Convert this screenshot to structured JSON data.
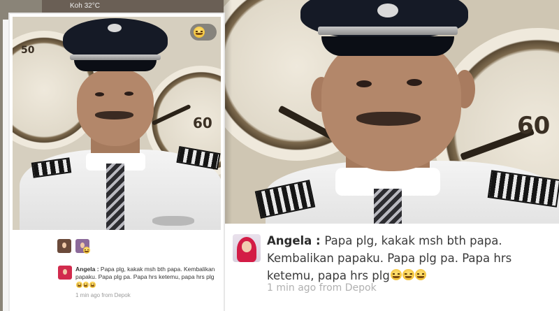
{
  "status_bar": {
    "text": "Koh 32°C"
  },
  "comments": {
    "author": "Angela",
    "separator": " : ",
    "message": "Papa plg, kakak msh bth papa. Kembalikan papaku. Papa plg pa. Papa hrs ketemu, papa hrs plg",
    "crying_emoji_count": 3,
    "time": "1 min ago from Depok"
  },
  "small_card": {
    "reaction_icons": [
      "crying-emoji-icon",
      "smile-emoji-icon"
    ]
  },
  "photo": {
    "dial_number": "60",
    "small_dial_labels": [
      "50",
      "60"
    ]
  },
  "colors": {
    "hijab": "#d31c46",
    "cap": "#151a26",
    "shirt": "#f4f4f4"
  }
}
